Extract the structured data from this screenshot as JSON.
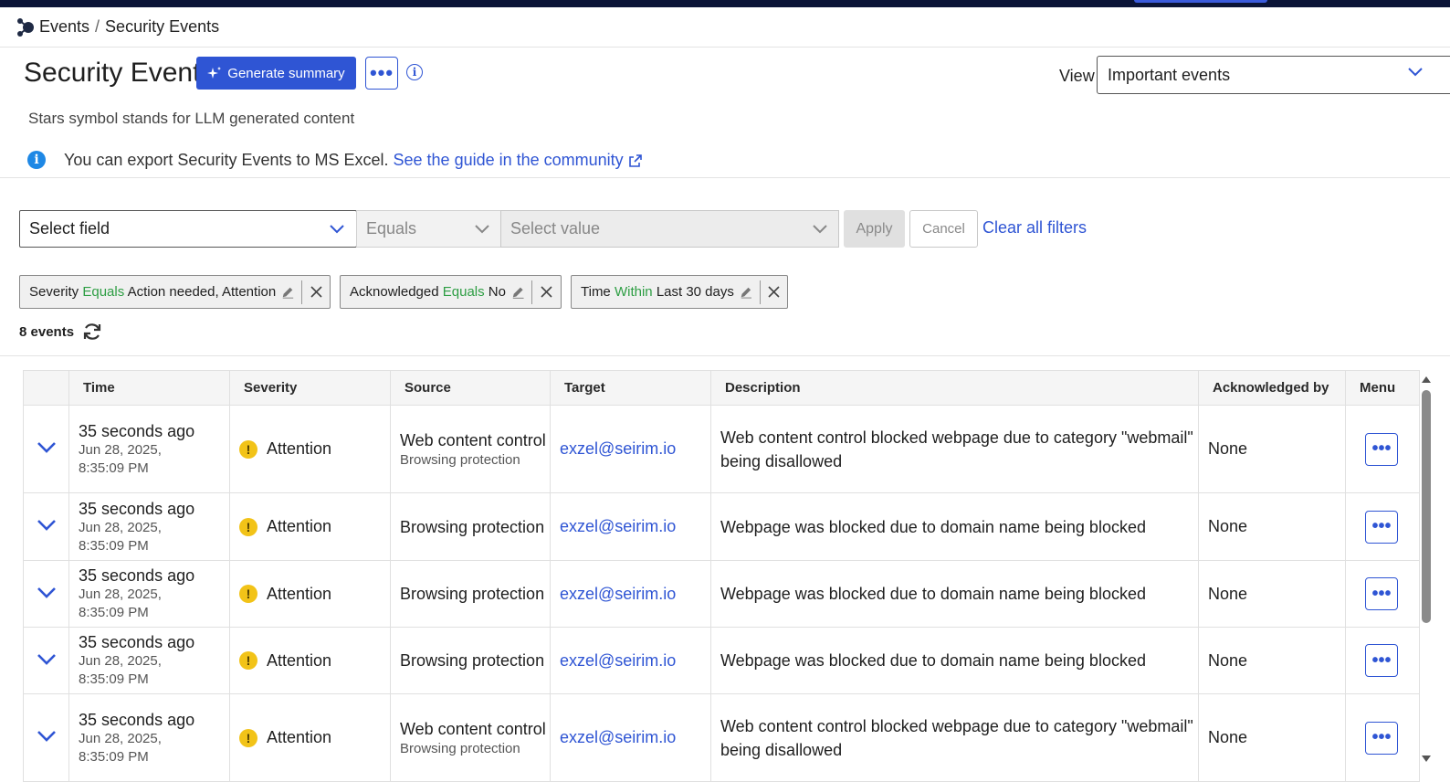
{
  "breadcrumb": {
    "root": "Events",
    "separator": "/",
    "current": "Security Events"
  },
  "header": {
    "title": "Security Events",
    "generate_summary_label": "Generate summary",
    "more_label": "•••",
    "info_label": "i",
    "view_label": "View",
    "view_value": "Important events"
  },
  "notes": {
    "stars_note": "Stars symbol stands for LLM generated content",
    "info_text": "You can export Security Events to MS Excel. ",
    "info_link": "See the guide in the community",
    "info_icon": "i"
  },
  "filter": {
    "field_value": "Select field",
    "operator_value": "Equals",
    "value_value": "Select value",
    "apply_label": "Apply",
    "cancel_label": "Cancel",
    "clear_label": "Clear all filters"
  },
  "chips": [
    {
      "field": "Severity",
      "operator": "Equals",
      "value": "Action needed, Attention"
    },
    {
      "field": "Acknowledged",
      "operator": "Equals",
      "value": "No"
    },
    {
      "field": "Time",
      "operator": "Within",
      "value": "Last 30 days"
    }
  ],
  "count_label": "8 events",
  "table": {
    "columns": [
      "Time",
      "Severity",
      "Source",
      "Target",
      "Description",
      "Acknowledged by",
      "Menu"
    ],
    "rows": [
      {
        "time_ago": "35 seconds ago",
        "date": "Jun 28, 2025,",
        "clock": "8:35:09 PM",
        "severity": "Attention",
        "source": "Web content control",
        "source_sub": "Browsing protection",
        "target": "exzel@seirim.io",
        "description": "Web content control blocked webpage due to category \"webmail\" being disallowed",
        "acknowledged": "None",
        "menu": "•••"
      },
      {
        "time_ago": "35 seconds ago",
        "date": "Jun 28, 2025,",
        "clock": "8:35:09 PM",
        "severity": "Attention",
        "source": "Browsing protection",
        "source_sub": "",
        "target": "exzel@seirim.io",
        "description": "Webpage was blocked due to domain name being blocked",
        "acknowledged": "None",
        "menu": "•••"
      },
      {
        "time_ago": "35 seconds ago",
        "date": "Jun 28, 2025,",
        "clock": "8:35:09 PM",
        "severity": "Attention",
        "source": "Browsing protection",
        "source_sub": "",
        "target": "exzel@seirim.io",
        "description": "Webpage was blocked due to domain name being blocked",
        "acknowledged": "None",
        "menu": "•••"
      },
      {
        "time_ago": "35 seconds ago",
        "date": "Jun 28, 2025,",
        "clock": "8:35:09 PM",
        "severity": "Attention",
        "source": "Browsing protection",
        "source_sub": "",
        "target": "exzel@seirim.io",
        "description": "Webpage was blocked due to domain name being blocked",
        "acknowledged": "None",
        "menu": "•••"
      },
      {
        "time_ago": "35 seconds ago",
        "date": "Jun 28, 2025,",
        "clock": "8:35:09 PM",
        "severity": "Attention",
        "source": "Web content control",
        "source_sub": "Browsing protection",
        "target": "exzel@seirim.io",
        "description": "Web content control blocked webpage due to category \"webmail\" being disallowed",
        "acknowledged": "None",
        "menu": "•••"
      }
    ]
  },
  "severity_icon_label": "!",
  "colors": {
    "accent": "#2f55d4",
    "operator_green": "#2e9e44",
    "attention_yellow": "#f2c318",
    "topbar": "#0b1437"
  }
}
